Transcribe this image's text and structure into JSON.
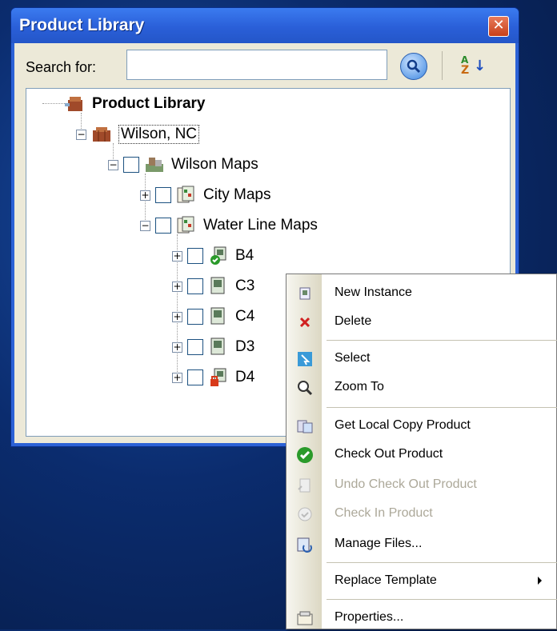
{
  "window": {
    "title": "Product Library"
  },
  "search": {
    "label": "Search for:",
    "value": "",
    "placeholder": ""
  },
  "tree": {
    "root": "Product Library",
    "site": "Wilson, NC",
    "group": "Wilson Maps",
    "city_maps": "City Maps",
    "water_line_maps": "Water Line Maps",
    "items": [
      "B4",
      "C3",
      "C4",
      "D3",
      "D4"
    ]
  },
  "menu": {
    "items": [
      {
        "label": "New Instance",
        "enabled": true,
        "icon": "new-instance-icon"
      },
      {
        "label": "Delete",
        "enabled": true,
        "icon": "delete-icon"
      },
      {
        "label": "Select",
        "enabled": true,
        "icon": "select-icon"
      },
      {
        "label": "Zoom To",
        "enabled": true,
        "icon": "zoom-icon"
      },
      {
        "label": "Get Local Copy Product",
        "enabled": true,
        "icon": "local-copy-icon"
      },
      {
        "label": "Check Out Product",
        "enabled": true,
        "icon": "checkout-icon"
      },
      {
        "label": "Undo Check Out Product",
        "enabled": false,
        "icon": "undo-checkout-icon"
      },
      {
        "label": "Check In Product",
        "enabled": false,
        "icon": "checkin-icon"
      },
      {
        "label": "Manage Files...",
        "enabled": true,
        "icon": "manage-files-icon"
      },
      {
        "label": "Replace Template",
        "enabled": true,
        "icon": "",
        "submenu": true
      },
      {
        "label": "Properties...",
        "enabled": true,
        "icon": "properties-icon"
      }
    ]
  },
  "colors": {
    "titlebar": "#2a5fd8",
    "client": "#ece9d8",
    "background": "#0b2c6e"
  }
}
